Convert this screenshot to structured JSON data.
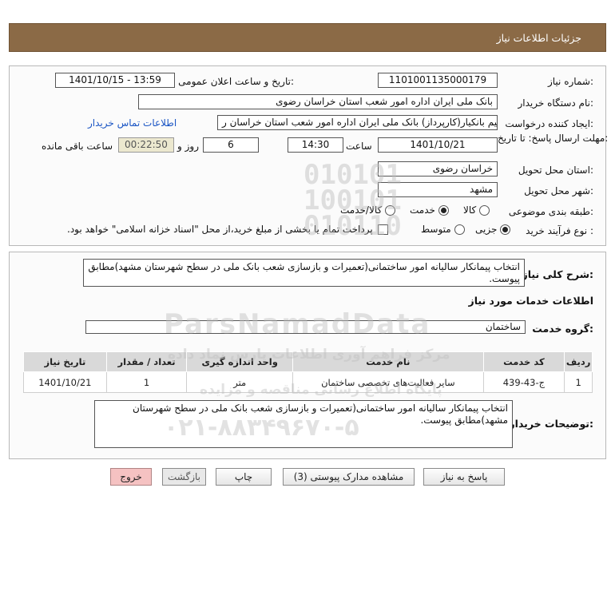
{
  "header": {
    "title": "جزئیات اطلاعات نیاز"
  },
  "fields": {
    "need_number_label": "شماره نیاز:",
    "need_number": "1101001135000179",
    "announce_label": "تاریخ و ساعت اعلان عمومی:",
    "announce_value": "1401/10/15 - 13:59",
    "buyer_org_label": "نام دستگاه خریدار:",
    "buyer_org": "بانک ملی ایران اداره امور شعب استان خراسان رضوی",
    "requester_label": "ایجاد کننده درخواست:",
    "requester": "محدرضا سلیم  بانکیار(کارپرداز) بانک ملی ایران اداره امور شعب استان خراسان ر",
    "contact_link": "اطلاعات تماس خریدار",
    "deadline_label": "مهلت ارسال پاسخ: تا تاریخ:",
    "deadline_date": "1401/10/21",
    "time_label": "ساعت",
    "deadline_time": "14:30",
    "days_value": "6",
    "days_label": "روز و",
    "remaining_time": "00:22:50",
    "remaining_label": "ساعت باقی مانده",
    "province_label": "استان محل تحویل:",
    "province": "خراسان رضوی",
    "city_label": "شهر محل تحویل:",
    "city": "مشهد",
    "category_label": "طبقه بندی موضوعی:",
    "category_options": [
      "کالا",
      "خدمت",
      "کالا/خدمت"
    ],
    "category_selected": "خدمت",
    "purchase_type_label": "نوع فرآیند خرید :",
    "purchase_options": [
      "جزیی",
      "متوسط"
    ],
    "purchase_selected": "جزیی",
    "payment_note": "پرداخت تمام یا بخشی از مبلغ خرید،از محل \"اسناد خزانه اسلامی\" خواهد بود."
  },
  "description": {
    "label": "شرح کلی نیاز:",
    "text": "انتخاب پیمانکار سالیانه امور ساختمانی(تعمیرات و بازسازی شعب بانک ملی در سطح شهرستان مشهد)مطابق پیوست."
  },
  "services": {
    "section_title": "اطلاعات خدمات مورد نیاز",
    "group_label": "گروه خدمت:",
    "group_value": "ساختمان",
    "columns": [
      "ردیف",
      "کد خدمت",
      "نام خدمت",
      "واحد اندازه گیری",
      "تعداد / مقدار",
      "تاریخ نیاز"
    ],
    "rows": [
      [
        "1",
        "ج-43-439",
        "سایر فعالیت‌های تخصصی ساختمان",
        "متر",
        "1",
        "1401/10/21"
      ]
    ]
  },
  "buyer_notes": {
    "label": "توضیحات خریدار:",
    "text": "انتخاب پیمانکار سالیانه امور ساختمانی(تعمیرات و بازسازی شعب بانک ملی در سطح شهرستان مشهد)مطابق پیوست."
  },
  "buttons": {
    "reply": "پاسخ به نیاز",
    "view_docs": "مشاهده مدارک پیوستی (3)",
    "print": "چاپ",
    "back": "بازگشت",
    "exit": "خروج"
  },
  "watermark": {
    "brand": "ParsNamadData",
    "subtitle": "مرکز فراهم آوری اطلاعات پارس نماد داده",
    "tagline": "پایگاه اطلاع رسانی مناقصه و مزایده",
    "phone": "۰۲۱-۸۸۳۴۹۶۷۰-۵"
  },
  "colors": {
    "header_bg": "#8b6a46",
    "link": "#1a55c4",
    "exit_btn": "#f5c2c2",
    "time_bg": "#ece8cf"
  }
}
